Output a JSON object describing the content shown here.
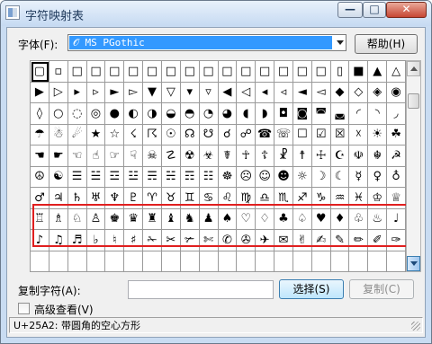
{
  "window": {
    "title": "字符映射表",
    "minimize_glyph": "—",
    "maximize_glyph": "□",
    "close_glyph": "✕"
  },
  "font_row": {
    "label": "字体(F):",
    "value": "𝒪 MS PGothic",
    "help_button": "帮助(H)"
  },
  "grid": {
    "rows": [
      [
        "▢",
        "▫",
        "□",
        "□",
        "□",
        "□",
        "□",
        "□",
        "□",
        "□",
        "□",
        "□",
        "□",
        "□",
        "□",
        "□",
        "▯",
        "■",
        "▲",
        "△"
      ],
      [
        "▶",
        "▷",
        "▸",
        "▹",
        "►",
        "▻",
        "▼",
        "▽",
        "▾",
        "▿",
        "◀",
        "◁",
        "◂",
        "◃",
        "◄",
        "◅",
        "◆",
        "◇",
        "◈",
        "◉"
      ],
      [
        "◊",
        "○",
        "◌",
        "◎",
        "●",
        "◐",
        "◑",
        "◒",
        "◓",
        "◔",
        "◕",
        "◖",
        "◗",
        "◘",
        "◙",
        "◚",
        "◛",
        "◜",
        "◝",
        "◞"
      ],
      [
        "☂",
        "☃",
        "☄",
        "★",
        "☆",
        "☇",
        "☈",
        "☉",
        "☊",
        "☋",
        "☌",
        "☍",
        "☎",
        "☏",
        "☐",
        "☑",
        "☒",
        "☓",
        "☀",
        "☘"
      ],
      [
        "☚",
        "☛",
        "☜",
        "☝",
        "☞",
        "☟",
        "☠",
        "☡",
        "☢",
        "☣",
        "☤",
        "☥",
        "☦",
        "☧",
        "☨",
        "☩",
        "☪",
        "☫",
        "☬",
        "☭"
      ],
      [
        "☮",
        "☯",
        "☰",
        "☱",
        "☲",
        "☳",
        "☴",
        "☵",
        "☶",
        "☷",
        "☸",
        "☹",
        "☺",
        "☻",
        "☼",
        "☽",
        "☾",
        "☿",
        "♀",
        "♁"
      ],
      [
        "♂",
        "♃",
        "♄",
        "♅",
        "♆",
        "♇",
        "♈",
        "♉",
        "♊",
        "♋",
        "♌",
        "♍",
        "♎",
        "♏",
        "♐",
        "♑",
        "♒",
        "♓",
        "♔",
        "♕"
      ],
      [
        "♖",
        "♗",
        "♘",
        "♙",
        "♚",
        "♛",
        "♜",
        "♝",
        "♞",
        "♟",
        "♠",
        "♡",
        "♢",
        "♣",
        "♤",
        "♥",
        "♦",
        "♧",
        "♨",
        "♩"
      ],
      [
        "♪",
        "♫",
        "♬",
        "♭",
        "♮",
        "♯",
        "✁",
        "✂",
        "✃",
        "✄",
        "✆",
        "✇",
        "✈",
        "✉",
        "✌",
        "✍",
        "✎",
        "✏",
        "✐",
        "✑"
      ]
    ]
  },
  "copy_row": {
    "label": "复制字符(A):",
    "value": "",
    "select_button": "选择(S)",
    "copy_button": "复制(C)"
  },
  "advanced": {
    "label": "高级查看(V)",
    "checked": false
  },
  "status_text": "U+25A2: 带圆角的空心方形"
}
